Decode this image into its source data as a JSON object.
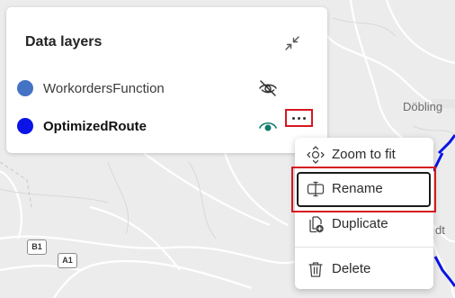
{
  "map": {
    "place_dobling": "Döbling",
    "place_partial": "dt",
    "road_b1": "B1",
    "road_a1": "A1"
  },
  "panel": {
    "title": "Data layers",
    "layers": [
      {
        "name": "WorkordersFunction",
        "color": "#4472c4",
        "visible": false
      },
      {
        "name": "OptimizedRoute",
        "color": "#0a14e6",
        "visible": true
      }
    ]
  },
  "context_menu": {
    "items": [
      {
        "label": "Zoom to fit",
        "icon": "zoom-to-fit-icon"
      },
      {
        "label": "Rename",
        "icon": "rename-icon"
      },
      {
        "label": "Duplicate",
        "icon": "duplicate-icon"
      },
      {
        "label": "Delete",
        "icon": "delete-icon"
      }
    ]
  },
  "colors": {
    "highlight_red": "#d6171f",
    "visible_eye": "#0f7b6c",
    "route_blue": "#0a14e6"
  }
}
